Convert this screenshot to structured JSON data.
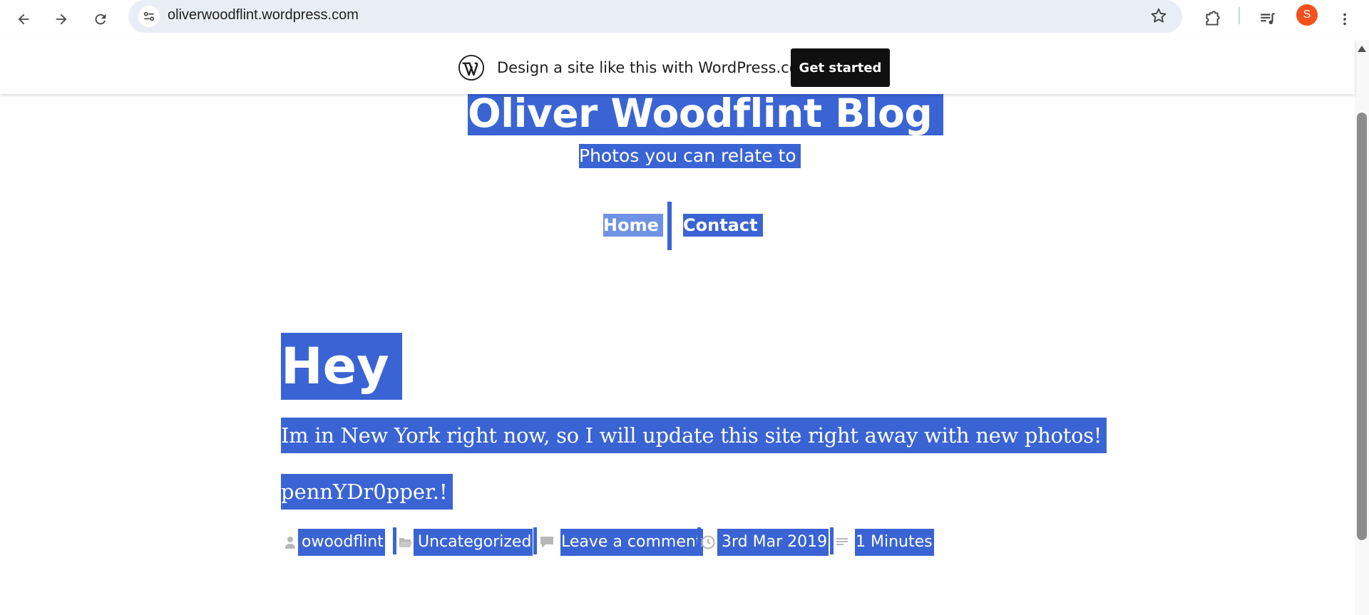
{
  "browser": {
    "url": "oliverwoodflint.wordpress.com",
    "profile_initial": "S",
    "profile_color": "#f4511e"
  },
  "wp_banner": {
    "text": "Design a site like this with WordPress.com",
    "cta": "Get started"
  },
  "site": {
    "title": "Oliver Woodflint Blog",
    "tagline": "Photos you can relate to",
    "menu": [
      "Home",
      "Contact"
    ]
  },
  "post": {
    "title": "Hey",
    "paragraphs": [
      "Im in New York right now, so I will update this site right away with new photos!",
      "pennYDr0pper.!"
    ],
    "meta": {
      "author": "owoodflint",
      "category": "Uncategorized",
      "comments": "Leave a comment",
      "date": "3rd Mar 2019",
      "read_time": "1 Minutes"
    }
  },
  "colors": {
    "selection": "#3a64d4",
    "selection_light": "#6f92e4",
    "cta_bg": "#101010"
  }
}
